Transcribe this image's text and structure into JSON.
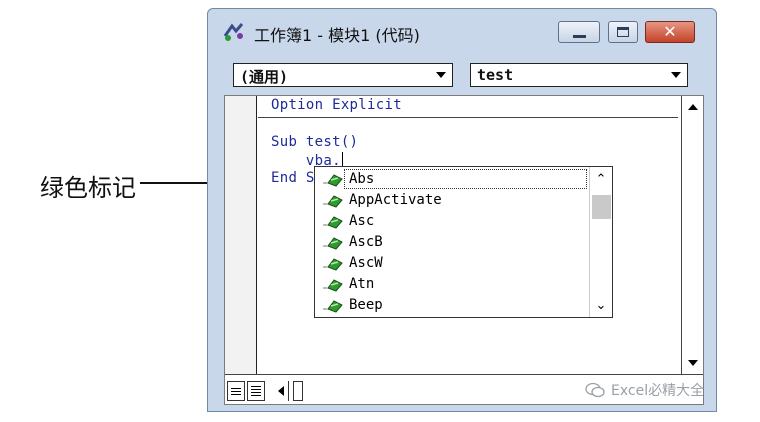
{
  "window": {
    "title": "工作簿1 - 模块1 (代码)",
    "close_glyph": "✕"
  },
  "combos": {
    "object_value": "(通用)",
    "procedure_value": "test"
  },
  "code": {
    "lines": [
      "Option Explicit",
      "Sub test()",
      "    vba.",
      "End S"
    ]
  },
  "autocomplete": {
    "items": [
      {
        "label": "Abs",
        "icon": "green-method-icon"
      },
      {
        "label": "AppActivate",
        "icon": "green-method-icon"
      },
      {
        "label": "Asc",
        "icon": "green-method-icon"
      },
      {
        "label": "AscB",
        "icon": "green-method-icon"
      },
      {
        "label": "AscW",
        "icon": "green-method-icon"
      },
      {
        "label": "Atn",
        "icon": "green-method-icon"
      },
      {
        "label": "Beep",
        "icon": "green-method-icon"
      }
    ],
    "selected_index": 0,
    "scroll_up_glyph": "⌃",
    "scroll_down_glyph": "⌄"
  },
  "annotation": {
    "label": "绿色标记"
  },
  "watermark": {
    "text": "Excel必精大全"
  },
  "colors": {
    "code_text": "#1d2a99",
    "method_icon": "#2f9a2f",
    "titlebar": "#c8d8ea",
    "close_button": "#c3432a"
  }
}
